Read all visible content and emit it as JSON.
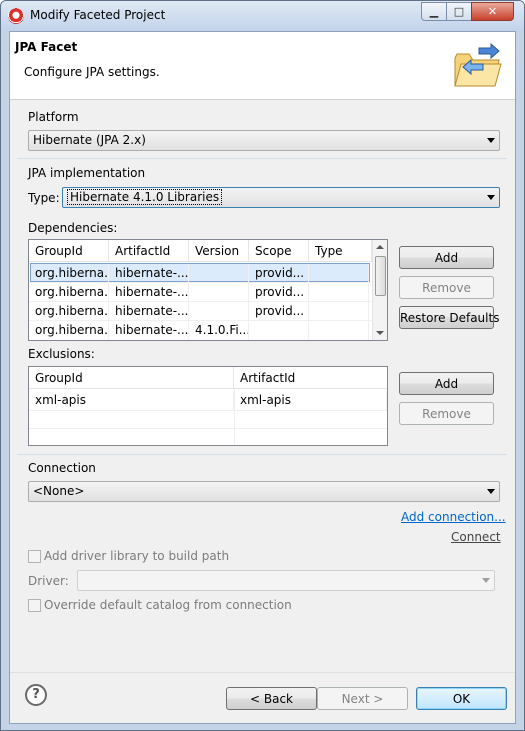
{
  "window": {
    "title": "Modify Faceted Project",
    "minimize": "▁",
    "maximize": "□",
    "close": "✕"
  },
  "header": {
    "title": "JPA Facet",
    "description": "Configure JPA settings."
  },
  "platform": {
    "label": "Platform",
    "value": "Hibernate (JPA 2.x)"
  },
  "jpa_impl": {
    "label": "JPA implementation",
    "type_label": "Type:",
    "type_value": "Hibernate 4.1.0 Libraries"
  },
  "dependencies": {
    "label": "Dependencies:",
    "columns": [
      "GroupId",
      "ArtifactId",
      "Version",
      "Scope",
      "Type"
    ],
    "rows": [
      [
        "org.hiberna...",
        "hibernate-...",
        "",
        "provid...",
        ""
      ],
      [
        "org.hiberna...",
        "hibernate-...",
        "",
        "provid...",
        ""
      ],
      [
        "org.hiberna...",
        "hibernate-...",
        "",
        "provid...",
        ""
      ],
      [
        "org.hiberna...",
        "hibernate-...",
        "4.1.0.Fi...",
        "",
        ""
      ]
    ],
    "add": "Add",
    "remove": "Remove",
    "restore": "Restore Defaults"
  },
  "exclusions": {
    "label": "Exclusions:",
    "columns": [
      "GroupId",
      "ArtifactId"
    ],
    "rows": [
      [
        "xml-apis",
        "xml-apis"
      ]
    ],
    "add": "Add",
    "remove": "Remove"
  },
  "connection": {
    "label": "Connection",
    "value": "<None>",
    "add_link": "Add connection...",
    "connect_link": "Connect",
    "driver_checkbox": "Add driver library to build path",
    "driver_label": "Driver:",
    "driver_value": "",
    "override_checkbox": "Override default catalog from connection"
  },
  "footer": {
    "help": "?",
    "back": "< Back",
    "next": "Next >",
    "ok": "OK"
  }
}
